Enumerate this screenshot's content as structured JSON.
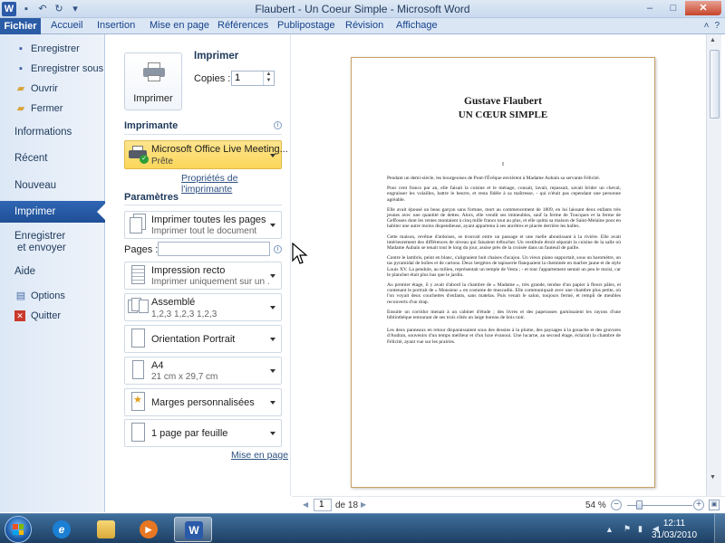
{
  "window": {
    "title": "Flaubert - Un Coeur Simple  -  Microsoft Word",
    "logo_letter": "W",
    "controls": {
      "minimize": "–",
      "maximize": "□",
      "close": "✕"
    }
  },
  "ribbon": {
    "file_tab": "Fichier",
    "tabs": [
      "Accueil",
      "Insertion",
      "Mise en page",
      "Références",
      "Publipostage",
      "Révision",
      "Affichage"
    ]
  },
  "nav": {
    "save": "Enregistrer",
    "save_as": "Enregistrer sous",
    "open": "Ouvrir",
    "close": "Fermer",
    "info": "Informations",
    "recent": "Récent",
    "new": "Nouveau",
    "print": "Imprimer",
    "save_send_1": "Enregistrer",
    "save_send_2": "et envoyer",
    "help": "Aide",
    "options": "Options",
    "quit": "Quitter"
  },
  "print": {
    "button_label": "Imprimer",
    "header": "Imprimer",
    "copies_label": "Copies :",
    "copies_value": "1"
  },
  "printer": {
    "header": "Imprimante",
    "name": "Microsoft Office Live Meeting...",
    "status": "Prête",
    "properties_link": "Propriétés de l'imprimante"
  },
  "settings": {
    "header": "Paramètres",
    "range": {
      "main": "Imprimer toutes les pages",
      "sub": "Imprimer tout le document"
    },
    "pages_label": "Pages :",
    "sides": {
      "main": "Impression recto",
      "sub": "Imprimer uniquement sur un ..."
    },
    "collate": {
      "main": "Assemblé",
      "sub": "1,2,3    1,2,3    1,2,3"
    },
    "orientation": {
      "main": "Orientation Portrait"
    },
    "paper": {
      "main": "A4",
      "sub": "21 cm x 29,7 cm"
    },
    "margins": {
      "main": "Marges personnalisées"
    },
    "per_sheet": {
      "main": "1 page par feuille"
    },
    "page_setup_link": "Mise en page"
  },
  "document": {
    "author": "Gustave Flaubert",
    "title": "UN CŒUR SIMPLE",
    "chapter": "I",
    "paragraphs": [
      "Pendant un demi-siècle, les bourgeoises de Pont-l'Évêque envièrent à Madame Aubain sa servante Félicité.",
      "Pour cent francs par an, elle faisait la cuisine et le ménage, cousait, lavait, repassait, savait brider un cheval, engraisser les volailles, battre le beurre, et resta fidèle à sa maîtresse, - qui n'était pas cependant une personne agréable.",
      "Elle avait épousé un beau garçon sans fortune, mort au commencement de 1809, en lui laissant deux enfants très jeunes avec une quantité de dettes. Alors, elle vendit ses immeubles, sauf la ferme de Toucques et la ferme de Geffosses dont les rentes montaient à cinq mille francs tout au plus, et elle quitta sa maison de Saint-Melaine pour en habiter une autre moins dispendieuse, ayant appartenu à ses ancêtres et placée derrière les halles.",
      "Cette maison, revêtue d'ardoises, se trouvait entre un passage et une ruelle aboutissant à la rivière. Elle avait intérieurement des différences de niveau qui faisaient trébucher. Un vestibule étroit séparait la cuisine de la salle où Madame Aubain se tenait tout le long du jour, assise près de la croisée dans un fauteuil de paille.",
      "Contre le lambris, peint en blanc, s'alignaient huit chaises d'acajou. Un vieux piano supportait, sous un baromètre, un tas pyramidal de boîtes et de cartons. Deux bergères de tapisserie flanquaient la cheminée en marbre jaune et de style Louis XV. La pendule, au milieu, représentait un temple de Vesta ; - et tout l'appartement sentait un peu le moisi, car le plancher était plus bas que le jardin.",
      "Au premier étage, il y avait d'abord la chambre de « Madame », très grande, tendue d'un papier à fleurs pâles, et contenant le portrait de « Monsieur » en costume de muscadin. Elle communiquait avec une chambre plus petite, où l'on voyait deux couchettes d'enfants, sans matelas. Puis venait le salon, toujours fermé, et rempli de meubles recouverts d'un drap.",
      "Ensuite un corridor menait à un cabinet d'étude ; des livres et des paperasses garnissaient les rayons d'une bibliothèque entourant de ses trois côtés un large bureau de bois noir.",
      "Les deux panneaux en retour disparaissaient sous des dessins à la plume, des paysages à la gouache et des gravures d'Audran, souvenirs d'un temps meilleur et d'un luxe évanoui. Une lucarne, au second étage, éclairait la chambre de Félicité, ayant vue sur les prairies."
    ]
  },
  "preview_bar": {
    "page_current": "1",
    "page_of": "de 18",
    "zoom": "54 %",
    "zoom_level": 0.54
  },
  "taskbar": {
    "word_letter": "W",
    "time": "12:11",
    "date": "31/03/2010"
  }
}
